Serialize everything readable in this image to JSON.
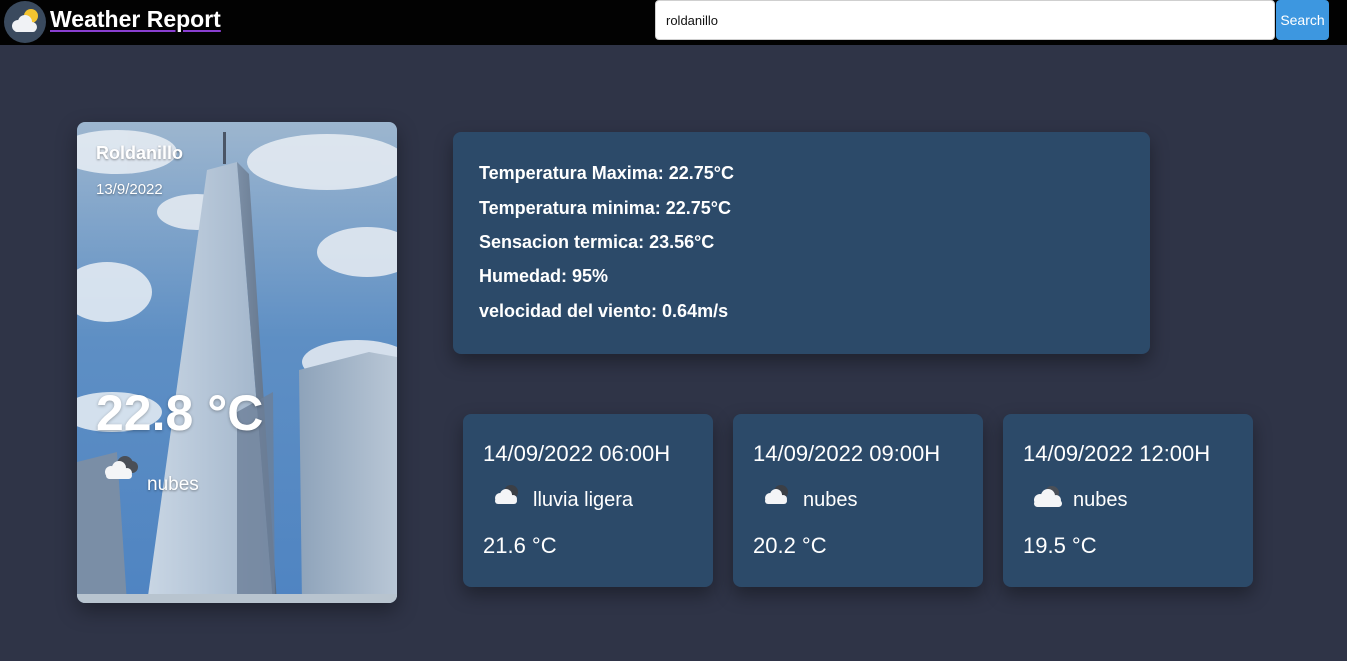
{
  "app": {
    "title": "Weather Report",
    "logo_icon": "partly-cloudy-icon"
  },
  "search": {
    "value": "roldanillo",
    "button_label": "Search"
  },
  "current": {
    "city": "Roldanillo",
    "date": "13/9/2022",
    "temperature": "22.8 °C",
    "description": "nubes",
    "icon": "cloud-icon"
  },
  "details": {
    "temp_max": "Temperatura Maxima: 22.75°C",
    "temp_min": "Temperatura minima: 22.75°C",
    "feels_like": "Sensacion termica: 23.56°C",
    "humidity": "Humedad: 95%",
    "wind": "velocidad del viento: 0.64m/s"
  },
  "forecast": [
    {
      "datetime": "14/09/2022 06:00H",
      "description": "lluvia ligera",
      "temperature": "21.6 °C",
      "icon": "cloud-night-icon"
    },
    {
      "datetime": "14/09/2022 09:00H",
      "description": "nubes",
      "temperature": "20.2 °C",
      "icon": "cloud-night-icon"
    },
    {
      "datetime": "14/09/2022 12:00H",
      "description": "nubes",
      "temperature": "19.5 °C",
      "icon": "cloud-icon"
    }
  ],
  "colors": {
    "background": "#2f3447",
    "header": "#020202",
    "card": "#2c4a69",
    "search_button": "#3d97e0",
    "title_underline": "#8a3fd1"
  }
}
